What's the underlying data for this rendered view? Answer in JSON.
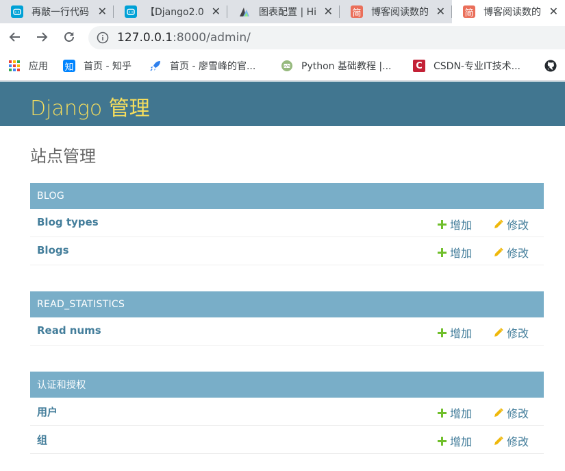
{
  "browser": {
    "tabs": [
      {
        "title": "再敲一行代码",
        "icon": "bilibili-icon",
        "color": "#00a1d6"
      },
      {
        "title": "【Django2.0",
        "icon": "bilibili-icon",
        "color": "#00a1d6"
      },
      {
        "title": "图表配置 | Hi",
        "icon": "highcharts-icon",
        "color": "#434348"
      },
      {
        "title": "博客阅读数的",
        "icon": "jianshu-icon",
        "color": "#ea6f5a"
      },
      {
        "title": "博客阅读数的",
        "icon": "jianshu-icon",
        "color": "#ea6f5a"
      }
    ],
    "address": {
      "host": "127.0.0.1",
      "rest": ":8000/admin/"
    },
    "bookmarks": [
      {
        "label": "应用",
        "icon": "apps-grid-icon"
      },
      {
        "label": "首页 - 知乎",
        "icon": "zhihu-icon"
      },
      {
        "label": "首页 - 廖雪峰的官...",
        "icon": "rocket-icon"
      },
      {
        "label": "Python 基础教程 |...",
        "icon": "runoob-icon"
      },
      {
        "label": "CSDN-专业IT技术...",
        "icon": "csdn-icon"
      }
    ]
  },
  "admin": {
    "brand": "Django 管理",
    "page_title": "站点管理",
    "add_label": "增加",
    "change_label": "修改",
    "modules": [
      {
        "caption": "BLOG",
        "models": [
          {
            "name": "Blog types"
          },
          {
            "name": "Blogs"
          }
        ]
      },
      {
        "caption": "READ_STATISTICS",
        "models": [
          {
            "name": "Read nums"
          }
        ]
      },
      {
        "caption": "认证和授权",
        "models": [
          {
            "name": "用户"
          },
          {
            "name": "组"
          }
        ]
      }
    ]
  },
  "colors": {
    "header_bg": "#417690",
    "brand_text": "#f5dd5d",
    "caption_bg": "#79aec8",
    "link": "#447e9b",
    "add_icon": "#70bf2b",
    "change_icon": "#efb80b"
  }
}
